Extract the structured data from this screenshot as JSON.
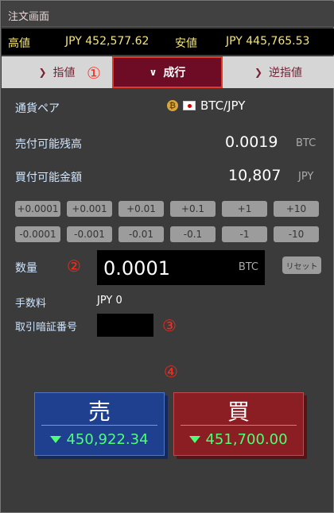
{
  "window": {
    "title": "注文画面"
  },
  "price_bar": {
    "high_label": "高値",
    "high_value": "JPY 452,577.62",
    "low_label": "安値",
    "low_value": "JPY 445,765.53"
  },
  "tabs": [
    {
      "label": "指値",
      "icon": "chevron-right-icon"
    },
    {
      "label": "成行",
      "icon": "chevron-down-icon"
    },
    {
      "label": "逆指値",
      "icon": "chevron-right-icon"
    }
  ],
  "markers": [
    "①",
    "②",
    "③",
    "④"
  ],
  "pair": {
    "label": "通貨ペア",
    "value": "BTC/JPY"
  },
  "sell_balance": {
    "label": "売付可能残高",
    "value": "0.0019",
    "unit": "BTC"
  },
  "buy_amount": {
    "label": "買付可能金額",
    "value": "10,807",
    "unit": "JPY"
  },
  "increment_buttons": [
    "+0.0001",
    "+0.001",
    "+0.01",
    "+0.1",
    "+1",
    "+10"
  ],
  "decrement_buttons": [
    "-0.0001",
    "-0.001",
    "-0.01",
    "-0.1",
    "-1",
    "-10"
  ],
  "quantity": {
    "label": "数量",
    "value": "0.0001",
    "unit": "BTC",
    "reset_label": "リセット"
  },
  "fee": {
    "label": "手数料",
    "value": "JPY 0"
  },
  "pin": {
    "label": "取引暗証番号",
    "value": ""
  },
  "sell_button": {
    "label": "売",
    "price": "450,922.34"
  },
  "buy_button": {
    "label": "買",
    "price": "451,700.00"
  },
  "colors": {
    "active_tab": "#6e0c26",
    "sell": "#1f3f8f",
    "buy": "#8a1e23",
    "price_green": "#4dff77",
    "marker_red": "#ff2a1a"
  }
}
